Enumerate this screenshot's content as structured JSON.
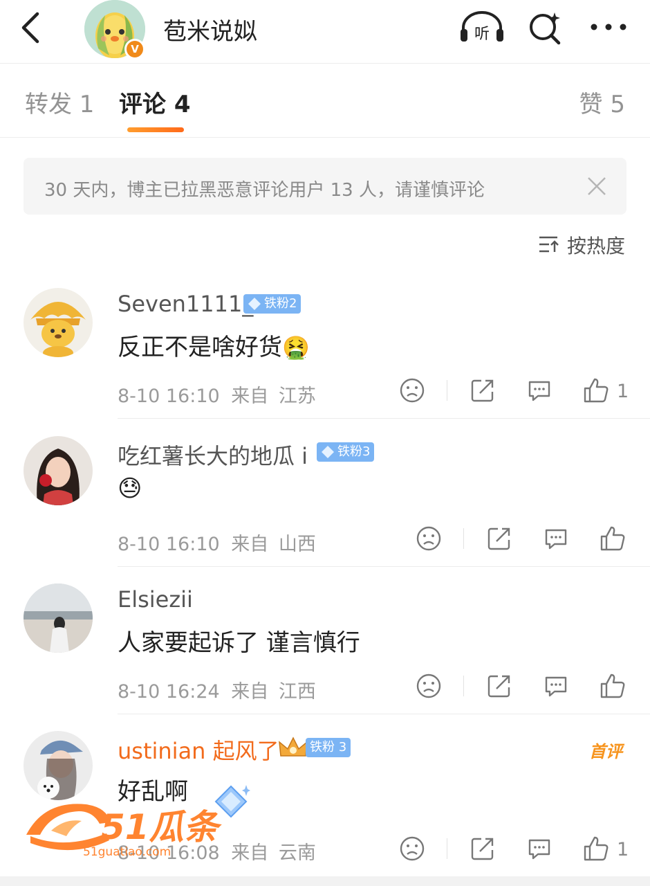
{
  "header": {
    "title": "苞米说姒",
    "verified_mark": "V",
    "listen_label": "听"
  },
  "tabs": {
    "repost": "转发 1",
    "comment": "评论 4",
    "like": "赞 5"
  },
  "notice": {
    "text": "30 天内，博主已拉黑恶意评论用户 13 人，请谨慎评论"
  },
  "sort": {
    "label": "按热度"
  },
  "comments": [
    {
      "name": "Seven1111_",
      "badge": "铁粉2",
      "text": "反正不是啥好货",
      "emoji": "🤮",
      "time": "8-10 16:10",
      "from": "来自",
      "location": "江苏",
      "likes": "1"
    },
    {
      "name": "吃红薯长大的地瓜 i",
      "badge": "铁粉3",
      "text": "",
      "emoji": "😓",
      "time": "8-10 16:10",
      "from": "来自",
      "location": "山西",
      "likes": ""
    },
    {
      "name": "Elsiezii",
      "badge": "",
      "text": "人家要起诉了 谨言慎行",
      "emoji": "",
      "time": "8-10 16:24",
      "from": "来自",
      "location": "江西",
      "likes": ""
    },
    {
      "name": "ustinian 起风了",
      "badge": "铁粉 3",
      "text": "好乱啊",
      "emoji": "",
      "time": "8-10 16:08",
      "from": "来自",
      "location": "云南",
      "likes": "1",
      "first_badge": "首评"
    }
  ],
  "watermark": {
    "brand": "51瓜条",
    "url": "51guatiao.com"
  },
  "colors": {
    "accent_orange": "#ff7a1f",
    "fan_badge_blue": "#7bb4f4",
    "name_orange": "#f26b1c"
  }
}
